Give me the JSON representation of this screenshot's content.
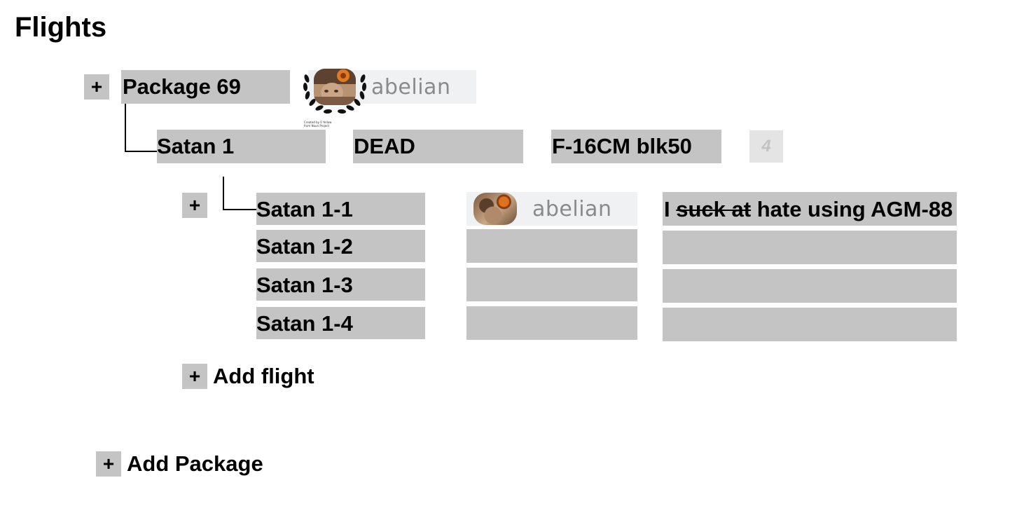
{
  "page": {
    "title": "Flights"
  },
  "package": {
    "expand_label": "+",
    "name": "Package 69",
    "owner": {
      "username": "abelian",
      "avatar_icon": "laurel-avatar-icon"
    },
    "credit": "Created by 0 Yellow from Noun Project"
  },
  "flight": {
    "name": "Satan 1",
    "status": "DEAD",
    "aircraft": "F-16CM blk50",
    "count": "4",
    "expand_label": "+",
    "members": [
      {
        "name": "Satan 1-1",
        "pilot": "abelian",
        "note_strike": "suck at",
        "note_prefix": "I ",
        "note_suffix": " hate using AGM-88"
      },
      {
        "name": "Satan 1-2",
        "pilot": "",
        "note": ""
      },
      {
        "name": "Satan 1-3",
        "pilot": "",
        "note": ""
      },
      {
        "name": "Satan 1-4",
        "pilot": "",
        "note": ""
      }
    ]
  },
  "actions": {
    "plus_symbol": "+",
    "add_flight": "Add flight",
    "add_package": "Add Package"
  },
  "colors": {
    "field_bg": "#c4c4c4",
    "chip_bg": "#f0f1f3",
    "count_bg": "#e4e4e4"
  }
}
